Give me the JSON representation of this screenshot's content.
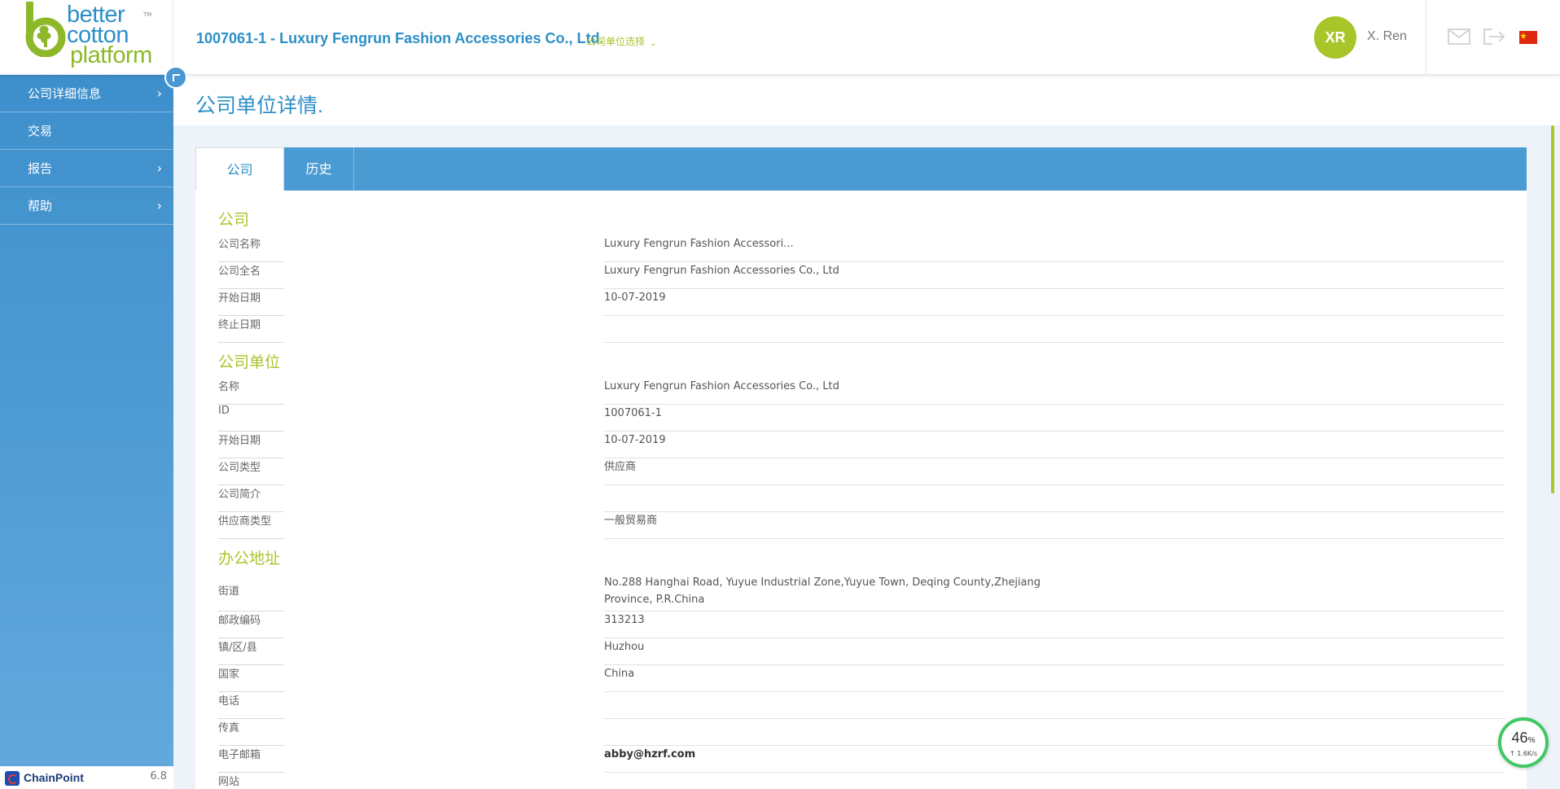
{
  "app": {
    "logo": {
      "line1": "better",
      "line2": "cotton",
      "line3": "platform",
      "tm": "TM"
    },
    "company_title": "1007061-1 - Luxury Fengrun Fashion Accessories Co., Ltd",
    "company_title_dot": ".",
    "unit_select_label": "公司单位选择",
    "user": {
      "initials": "XR",
      "name": "X. Ren"
    },
    "colors": {
      "primary": "#2d8fc6",
      "accent": "#a8c62a",
      "sidebar": "#4a9bd1"
    }
  },
  "sidebar": {
    "items": [
      {
        "label": "公司详细信息",
        "has_arrow": true
      },
      {
        "label": "交易",
        "has_arrow": false
      },
      {
        "label": "报告",
        "has_arrow": true
      },
      {
        "label": "帮助",
        "has_arrow": true
      }
    ],
    "footer": {
      "brand": "ChainPoint",
      "version": "6.8"
    }
  },
  "page": {
    "title": "公司单位详情",
    "title_dot": "."
  },
  "tabs": [
    {
      "label": "公司"
    },
    {
      "label": "历史"
    }
  ],
  "sections": {
    "company": {
      "title": "公司",
      "rows": [
        {
          "label": "公司名称",
          "value": "Luxury Fengrun Fashion Accessori..."
        },
        {
          "label": "公司全名",
          "value": "Luxury Fengrun Fashion Accessories Co., Ltd"
        },
        {
          "label": "开始日期",
          "value": "10-07-2019"
        },
        {
          "label": "终止日期",
          "value": ""
        }
      ]
    },
    "unit": {
      "title": "公司单位",
      "rows": [
        {
          "label": "名称",
          "value": "Luxury Fengrun Fashion Accessories Co., Ltd"
        },
        {
          "label": "ID",
          "value": "1007061-1"
        },
        {
          "label": "开始日期",
          "value": "10-07-2019"
        },
        {
          "label": "公司类型",
          "value": "供应商"
        },
        {
          "label": "公司简介",
          "value": ""
        },
        {
          "label": "供应商类型",
          "value": "一般贸易商"
        }
      ]
    },
    "address": {
      "title": "办公地址",
      "rows": [
        {
          "label": "街道",
          "value_line1": "No.288 Hanghai Road, Yuyue Industrial Zone,Yuyue Town, Deqing County,Zhejiang",
          "value_line2": "Province, P.R.China"
        },
        {
          "label": "邮政编码",
          "value": "313213"
        },
        {
          "label": "镇/区/县",
          "value": "Huzhou"
        },
        {
          "label": "国家",
          "value": "China"
        },
        {
          "label": "电话",
          "value": ""
        },
        {
          "label": "传真",
          "value": ""
        },
        {
          "label": "电子邮箱",
          "value": "abby@hzrf.com"
        },
        {
          "label": "网站",
          "value": ""
        }
      ]
    }
  },
  "net_widget": {
    "percent": "46",
    "percent_unit": "%",
    "speed": "↑ 1.6K/s"
  }
}
